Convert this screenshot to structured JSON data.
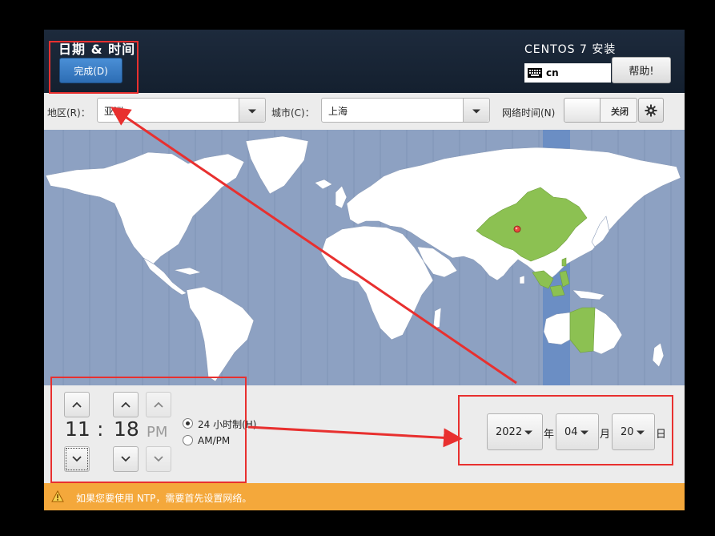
{
  "header": {
    "spoke_title": "日期 & 时间",
    "done_button": "完成(D)",
    "product_title": "CENTOS 7 安装",
    "keyboard_layout": "cn",
    "help_button": "帮助!"
  },
  "selectors": {
    "region_label": "地区(R)：",
    "region_value": "亚洲",
    "city_label": "城市(C)：",
    "city_value": "上海",
    "network_time_label": "网络时间(N)",
    "network_time_state": "关闭"
  },
  "time": {
    "hours": "11",
    "separator": ":",
    "minutes": "18",
    "ampm_indicator": "PM",
    "format_24h_label": "24 小时制(H)",
    "format_ampm_label": "AM/PM",
    "selected_format": "24h"
  },
  "date": {
    "year": "2022",
    "year_unit": "年",
    "month": "04",
    "month_unit": "月",
    "day": "20",
    "day_unit": "日"
  },
  "warning": {
    "message": "如果您要使用 NTP，需要首先设置网络。"
  },
  "colors": {
    "map_ocean": "#8da1c2",
    "land": "#ffffff",
    "selected_timezone_land": "#8cc152",
    "timezone_band": "#6b8ec4",
    "warning_bar": "#f4a83b",
    "annotation_red": "#e8302f"
  },
  "icons": {
    "keyboard": "keyboard-icon",
    "gear": "gear-icon",
    "warning": "warning-icon",
    "location_pin": "location-pin-icon"
  }
}
